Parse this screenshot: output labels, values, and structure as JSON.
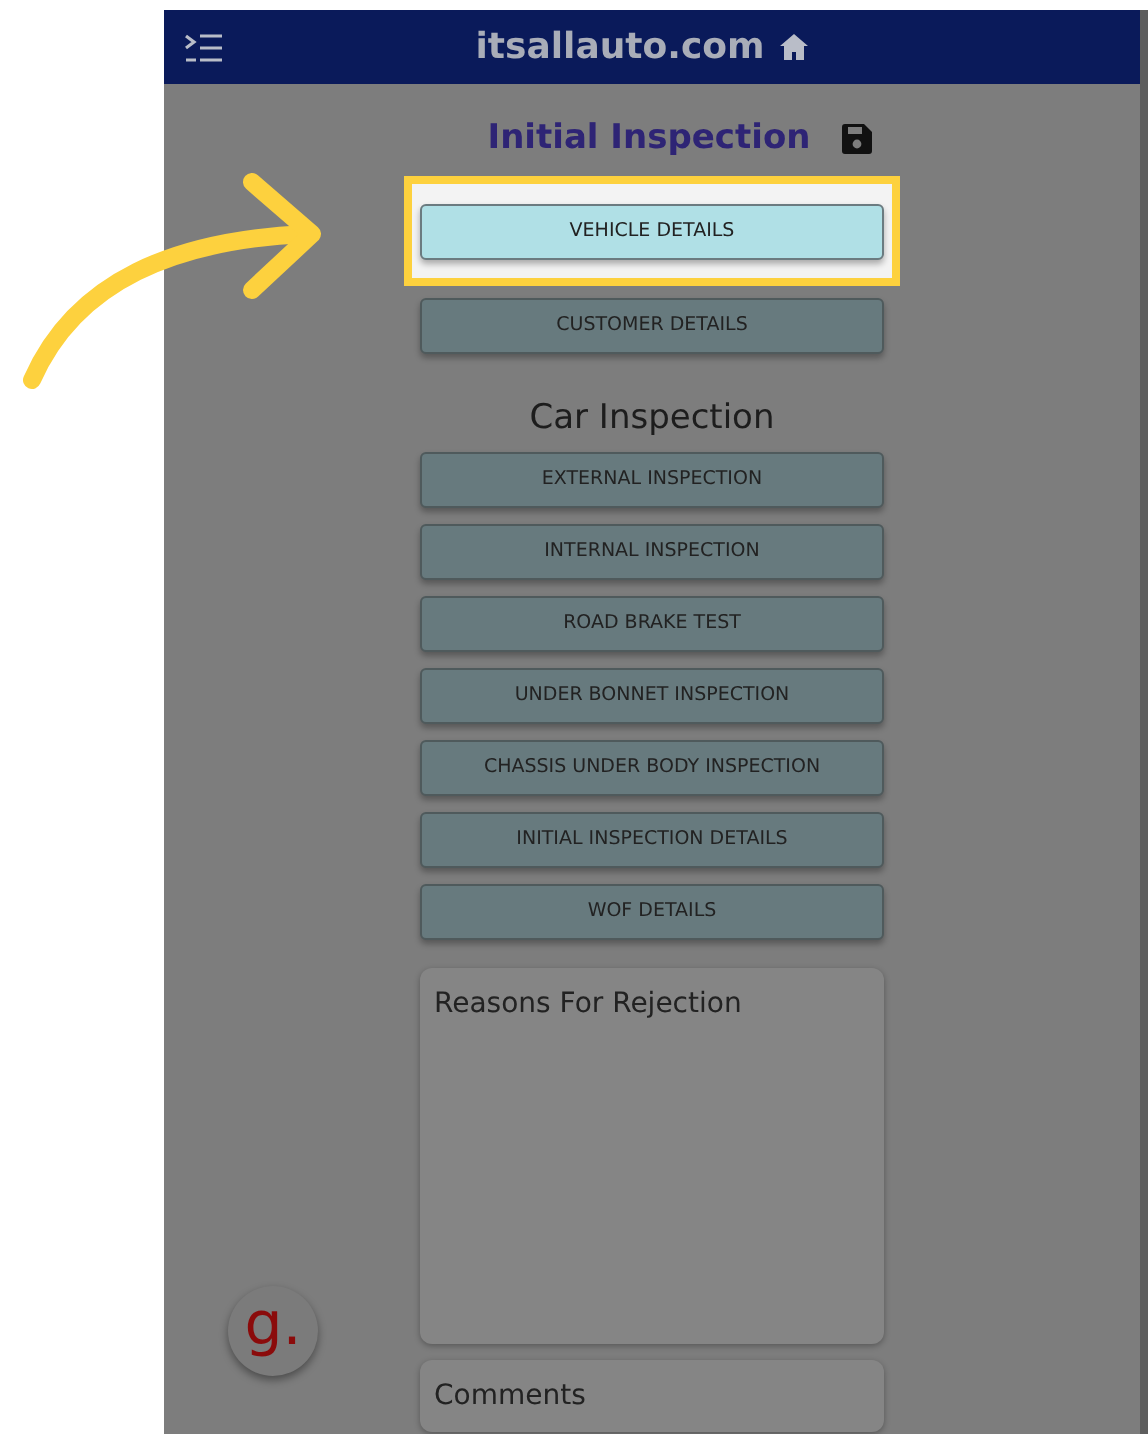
{
  "header": {
    "title": "itsallauto.com"
  },
  "page_title": "Initial Inspection",
  "top_buttons": [
    {
      "label": "VEHICLE DETAILS",
      "selected": true
    },
    {
      "label": "CUSTOMER DETAILS",
      "selected": false
    }
  ],
  "section_title": "Car Inspection",
  "inspection_buttons": [
    {
      "label": "EXTERNAL INSPECTION",
      "selected": false
    },
    {
      "label": "INTERNAL INSPECTION",
      "selected": false
    },
    {
      "label": "ROAD BRAKE TEST",
      "selected": false
    },
    {
      "label": "UNDER BONNET INSPECTION",
      "selected": false
    },
    {
      "label": "CHASSIS UNDER BODY INSPECTION",
      "selected": false
    },
    {
      "label": "INITIAL INSPECTION DETAILS",
      "selected": false
    },
    {
      "label": "WOF DETAILS",
      "selected": false
    }
  ],
  "panels": [
    {
      "title": "Reasons For Rejection"
    },
    {
      "title": "Comments"
    }
  ],
  "floating_button": {
    "label": "g."
  }
}
